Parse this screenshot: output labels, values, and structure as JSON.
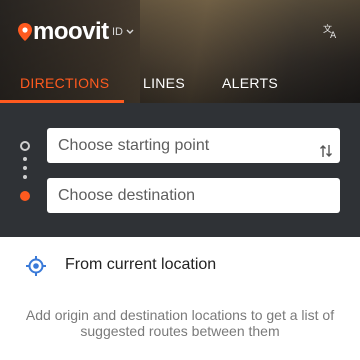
{
  "header": {
    "brand": "moovit",
    "language": "ID",
    "translate_icon": "translate-icon",
    "logo_icon": "location-pin-icon"
  },
  "tabs": [
    {
      "label": "DIRECTIONS",
      "active": true
    },
    {
      "label": "LINES",
      "active": false
    },
    {
      "label": "ALERTS",
      "active": false
    }
  ],
  "search": {
    "start_placeholder": "Choose starting point",
    "destination_placeholder": "Choose destination",
    "swap_icon": "swap-vertical-icon"
  },
  "current_location": {
    "label": "From current location",
    "icon": "crosshair-location-icon"
  },
  "hint_text": "Add origin and destination locations to get a list of suggested routes between them",
  "colors": {
    "accent": "#ff5a1f",
    "panel": "#2f3236",
    "location_icon": "#3a7ad8"
  }
}
